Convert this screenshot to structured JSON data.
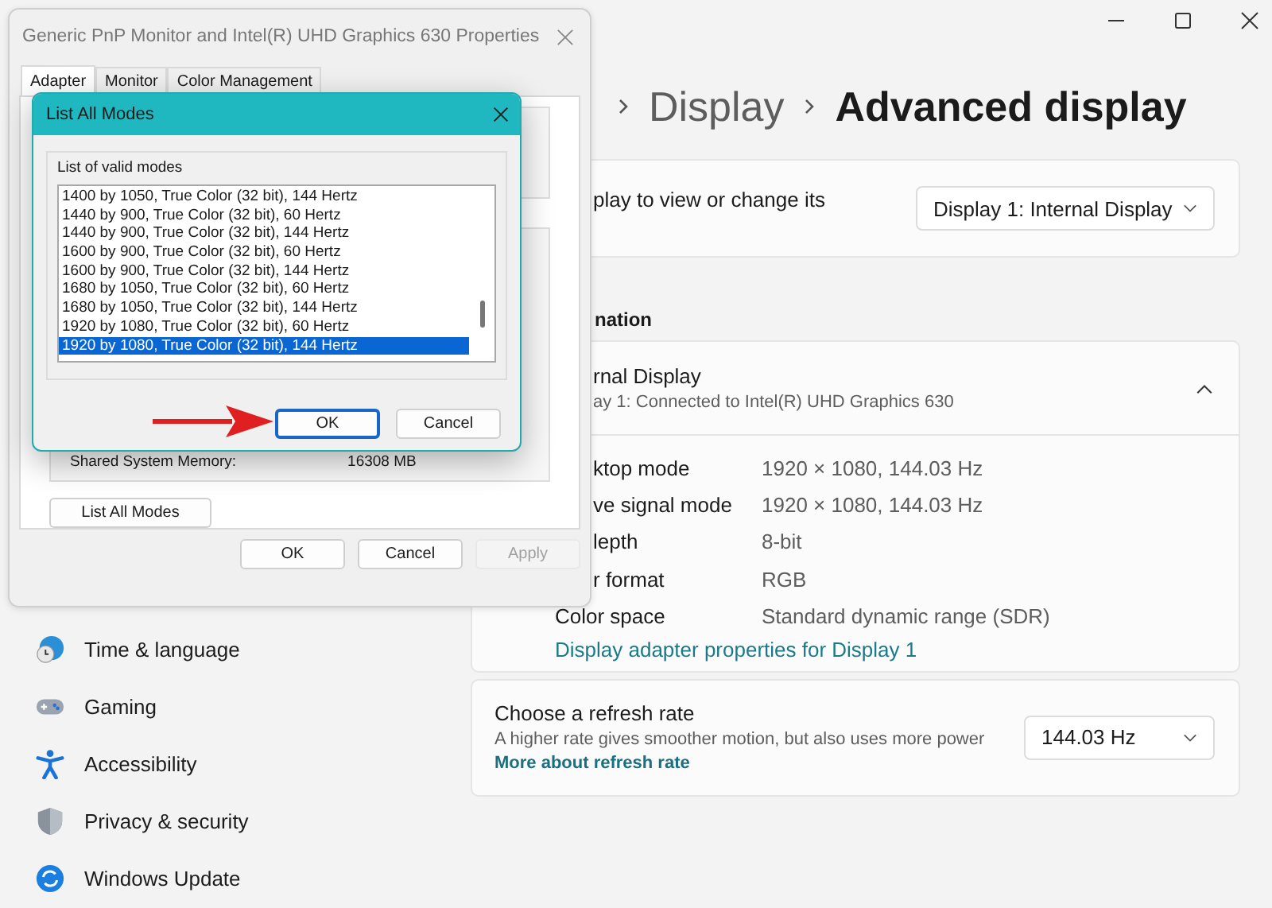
{
  "settings": {
    "breadcrumb": [
      "Display",
      "Advanced display"
    ],
    "select_display": {
      "text": "play to view or change its",
      "dropdown": "Display 1: Internal Display"
    },
    "section_heading": "nation",
    "display_info": {
      "title": "rnal Display",
      "subtitle": "ay 1: Connected to Intel(R) UHD Graphics 630",
      "expanded": true,
      "rows": [
        {
          "label": "ktop mode",
          "value": "1920 × 1080, 144.03 Hz"
        },
        {
          "label": "ve signal mode",
          "value": "1920 × 1080, 144.03 Hz"
        },
        {
          "label": "lepth",
          "value": "8-bit"
        },
        {
          "label": "r format",
          "value": "RGB"
        },
        {
          "label": "Color space",
          "value": "Standard dynamic range (SDR)"
        }
      ],
      "link": "Display adapter properties for Display 1"
    },
    "refresh_rate": {
      "title": "Choose a refresh rate",
      "description": "A higher rate gives smoother motion, but also uses more power",
      "link": "More about refresh rate",
      "dropdown": "144.03 Hz"
    },
    "sidebar": [
      {
        "label": "Time & language"
      },
      {
        "label": "Gaming"
      },
      {
        "label": "Accessibility"
      },
      {
        "label": "Privacy & security"
      },
      {
        "label": "Windows Update"
      }
    ]
  },
  "properties_dialog": {
    "title": "Generic PnP Monitor and Intel(R) UHD Graphics 630 Properties",
    "tabs": [
      {
        "label": "Adapter",
        "selected": true
      },
      {
        "label": "Monitor",
        "selected": false
      },
      {
        "label": "Color Management",
        "selected": false
      }
    ],
    "shared_memory": {
      "label": "Shared System Memory:",
      "value": "16308 MB"
    },
    "list_all_modes_button": "List All Modes",
    "buttons": [
      {
        "label": "OK",
        "disabled": false
      },
      {
        "label": "Cancel",
        "disabled": false
      },
      {
        "label": "Apply",
        "disabled": true
      }
    ]
  },
  "list_modes_dialog": {
    "title": "List All Modes",
    "group_label": "List of valid modes",
    "modes": [
      {
        "label": "1400 by 1050, True Color (32 bit), 144 Hertz",
        "selected": false
      },
      {
        "label": "1440 by 900, True Color (32 bit), 60 Hertz",
        "selected": false
      },
      {
        "label": "1440 by 900, True Color (32 bit), 144 Hertz",
        "selected": false
      },
      {
        "label": "1600 by 900, True Color (32 bit), 60 Hertz",
        "selected": false
      },
      {
        "label": "1600 by 900, True Color (32 bit), 144 Hertz",
        "selected": false
      },
      {
        "label": "1680 by 1050, True Color (32 bit), 60 Hertz",
        "selected": false
      },
      {
        "label": "1680 by 1050, True Color (32 bit), 144 Hertz",
        "selected": false
      },
      {
        "label": "1920 by 1080, True Color (32 bit), 60 Hertz",
        "selected": false
      },
      {
        "label": "1920 by 1080, True Color (32 bit), 144 Hertz",
        "selected": true
      }
    ],
    "buttons": [
      {
        "label": "OK",
        "focused": true
      },
      {
        "label": "Cancel",
        "focused": false
      }
    ]
  }
}
